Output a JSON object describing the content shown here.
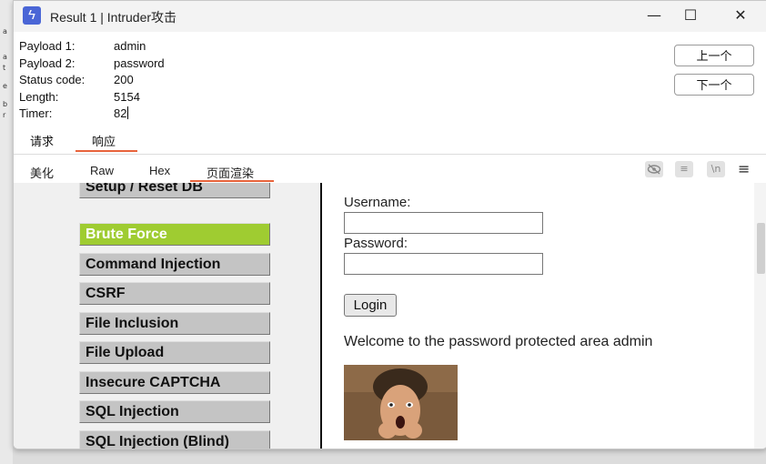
{
  "window": {
    "title": "Result 1 | Intruder攻击",
    "minimize": "—",
    "maximize": "☐",
    "close": "✕"
  },
  "background_fragments": [
    "a",
    "a",
    "t",
    "e",
    "b",
    "r"
  ],
  "info": [
    {
      "key": "Payload 1:",
      "value": "admin"
    },
    {
      "key": "Payload 2:",
      "value": "password"
    },
    {
      "key": "Status code:",
      "value": "200"
    },
    {
      "key": "Length:",
      "value": "5154"
    },
    {
      "key": "Timer:",
      "value": "82"
    }
  ],
  "nav": {
    "prev": "上一个",
    "next": "下一个"
  },
  "reqres_tabs": [
    {
      "label": "请求",
      "active": false
    },
    {
      "label": "响应",
      "active": true
    }
  ],
  "view_tabs": [
    {
      "label": "美化",
      "active": false
    },
    {
      "label": "Raw",
      "active": false
    },
    {
      "label": "Hex",
      "active": false
    },
    {
      "label": "页面渲染",
      "active": true
    }
  ],
  "tool_icons": [
    "eye-slash-icon",
    "wrap-icon",
    "newline-icon",
    "menu-icon"
  ],
  "tool_glyphs": {
    "wrap": "≡",
    "newline": "\\n",
    "menu": "≡"
  },
  "sidebar_menu": [
    {
      "label": "Setup / Reset DB",
      "active": false
    },
    {
      "label": "Brute Force",
      "active": true
    },
    {
      "label": "Command Injection",
      "active": false
    },
    {
      "label": "CSRF",
      "active": false
    },
    {
      "label": "File Inclusion",
      "active": false
    },
    {
      "label": "File Upload",
      "active": false
    },
    {
      "label": "Insecure CAPTCHA",
      "active": false
    },
    {
      "label": "SQL Injection",
      "active": false
    },
    {
      "label": "SQL Injection (Blind)",
      "active": false
    }
  ],
  "form": {
    "username_label": "Username:",
    "password_label": "Password:",
    "username_value": "",
    "password_value": "",
    "login_button": "Login"
  },
  "welcome_text": "Welcome to the password protected area admin",
  "colors": {
    "accent": "#e8643c",
    "active_menu": "#9fcc31",
    "app_icon": "#4a66d6"
  }
}
